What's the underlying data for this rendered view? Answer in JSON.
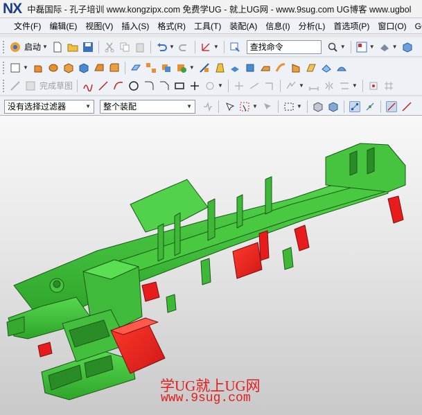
{
  "title_bar": {
    "logo": "NX",
    "text": "中磊国际 - 孔子培训 www.kongzipx.com 免费学UG - 就上UG网 - www.9sug.com  UG博客 www.ugbol"
  },
  "menu": {
    "items": [
      "文件(F)",
      "编辑(E)",
      "视图(V)",
      "插入(S)",
      "格式(R)",
      "工具(T)",
      "装配(A)",
      "信息(I)",
      "分析(L)",
      "首选项(P)",
      "窗口(O)",
      "GC 工"
    ]
  },
  "toolbar1": {
    "start_label": "启动",
    "search_value": "查找命令"
  },
  "toolbar3": {
    "finish_sketch_label": "完成草图"
  },
  "toolbar4": {
    "filter_value": "没有选择过滤器",
    "scope_value": "整个装配"
  },
  "viewport": {
    "watermark_line1": "学UG就上UG网",
    "watermark_line2": "www.9sug.com"
  },
  "colors": {
    "model_green": "#3fc23a",
    "model_green_dark": "#1f7a1c",
    "model_red": "#e81c1c",
    "accent_blue": "#1a3c8a"
  }
}
